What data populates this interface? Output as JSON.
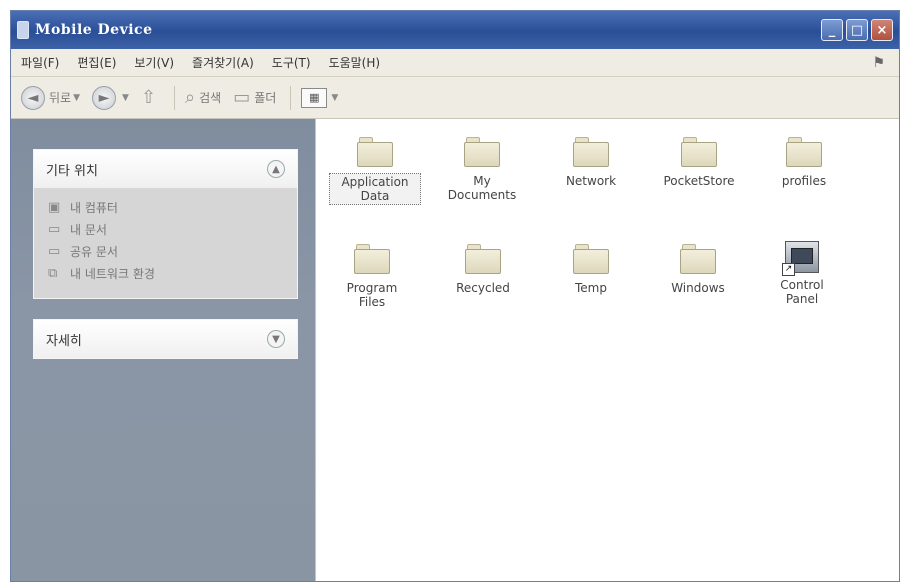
{
  "window": {
    "title": "Mobile Device",
    "controls": {
      "minimize": "_",
      "maximize": "□",
      "close": "×"
    }
  },
  "menubar": {
    "items": [
      "파일(F)",
      "편집(E)",
      "보기(V)",
      "즐겨찾기(A)",
      "도구(T)",
      "도움말(H)"
    ]
  },
  "toolbar": {
    "back_label": "뒤로",
    "search_label": "검색",
    "folders_label": "폴더"
  },
  "sidebar": {
    "other_places": {
      "title": "기타 위치",
      "links": [
        {
          "label": "내 컴퓨터",
          "icon": "computer-icon"
        },
        {
          "label": "내 문서",
          "icon": "documents-icon"
        },
        {
          "label": "공유 문서",
          "icon": "shared-folder-icon"
        },
        {
          "label": "내 네트워크 환경",
          "icon": "network-icon"
        }
      ]
    },
    "details": {
      "title": "자세히"
    }
  },
  "files": [
    {
      "name": "Application Data",
      "type": "folder",
      "selected": true
    },
    {
      "name": "My Documents",
      "type": "folder"
    },
    {
      "name": "Network",
      "type": "folder"
    },
    {
      "name": "PocketStore",
      "type": "folder"
    },
    {
      "name": "profiles",
      "type": "folder"
    },
    {
      "name": "Program Files",
      "type": "folder"
    },
    {
      "name": "Recycled",
      "type": "folder"
    },
    {
      "name": "Temp",
      "type": "folder"
    },
    {
      "name": "Windows",
      "type": "folder"
    },
    {
      "name": "Control Panel",
      "type": "shortcut"
    }
  ]
}
